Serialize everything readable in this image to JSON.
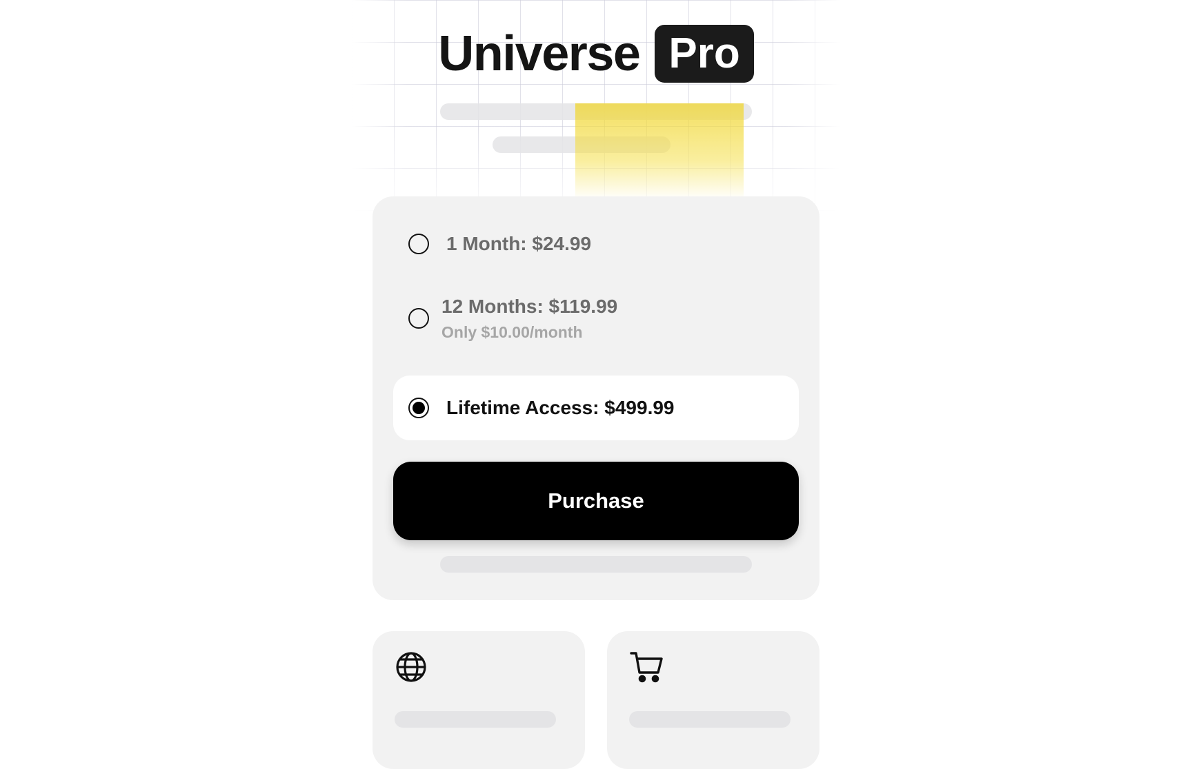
{
  "header": {
    "title_word": "Universe",
    "badge": "Pro"
  },
  "plans": {
    "selected_index": 2,
    "options": [
      {
        "label": "1 Month: $24.99",
        "sublabel": ""
      },
      {
        "label": "12 Months: $119.99",
        "sublabel": "Only $10.00/month"
      },
      {
        "label": "Lifetime Access: $499.99",
        "sublabel": ""
      }
    ]
  },
  "actions": {
    "purchase_label": "Purchase"
  },
  "feature_cards": [
    {
      "icon": "globe-icon"
    },
    {
      "icon": "cart-icon"
    }
  ],
  "colors": {
    "accent_highlight": "#F0D634",
    "primary_button": "#000000",
    "card_background": "#F2F2F2"
  }
}
